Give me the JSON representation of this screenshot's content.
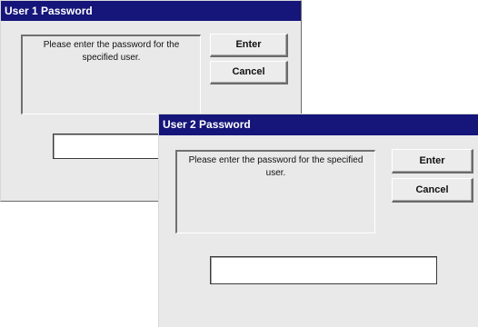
{
  "dialogs": [
    {
      "title": "User 1 Password",
      "message": "Please enter the password for the specified user.",
      "enter_label": "Enter",
      "cancel_label": "Cancel",
      "password_value": ""
    },
    {
      "title": "User 2 Password",
      "message": "Please enter the password for the specified user.",
      "enter_label": "Enter",
      "cancel_label": "Cancel",
      "password_value": ""
    }
  ],
  "colors": {
    "titlebar": "#15157a",
    "dialog_background": "#e9e9e9"
  }
}
